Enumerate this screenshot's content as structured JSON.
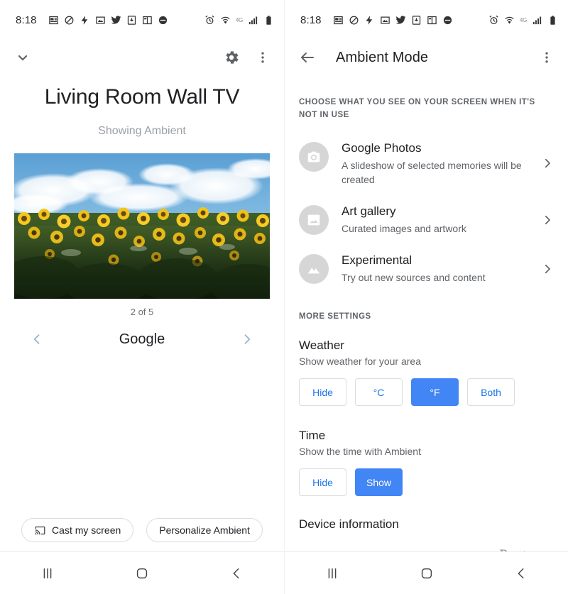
{
  "statusbar": {
    "time": "8:18",
    "left_icons": [
      "news-icon",
      "no-sim-icon",
      "flash-icon",
      "photo-icon",
      "twitter-icon",
      "download-icon",
      "book-icon",
      "more-notifications-icon"
    ],
    "right_icons": [
      "alarm-icon",
      "wifi-icon",
      "signal-icon",
      "battery-icon"
    ],
    "network_label": "4G"
  },
  "left": {
    "header": {
      "collapse_icon": "chevron-down-icon",
      "settings_icon": "gear-icon",
      "overflow_icon": "more-vertical-icon"
    },
    "device_title": "Living Room Wall TV",
    "device_status": "Showing Ambient",
    "photo_alt": "sunflower-field-photo",
    "counter": "2 of 5",
    "carousel": {
      "prev_icon": "chevron-left-icon",
      "label": "Google",
      "next_icon": "chevron-right-icon"
    },
    "actions": {
      "cast_icon": "cast-icon",
      "cast_label": "Cast my screen",
      "personalize_label": "Personalize Ambient"
    }
  },
  "right": {
    "header": {
      "back_icon": "arrow-left-icon",
      "title": "Ambient Mode",
      "overflow_icon": "more-vertical-icon"
    },
    "section_choose": "CHOOSE WHAT YOU SEE ON YOUR SCREEN WHEN IT'S NOT IN USE",
    "sources": [
      {
        "icon": "camera-icon",
        "title": "Google Photos",
        "desc": "A slideshow of selected memories will be created",
        "chevron": "chevron-right-icon"
      },
      {
        "icon": "image-icon",
        "title": "Art gallery",
        "desc": "Curated images and artwork",
        "chevron": "chevron-right-icon"
      },
      {
        "icon": "mountain-icon",
        "title": "Experimental",
        "desc": "Try out new sources and content",
        "chevron": "chevron-right-icon"
      }
    ],
    "section_more": "MORE SETTINGS",
    "weather": {
      "title": "Weather",
      "desc": "Show weather for your area",
      "options": [
        {
          "label": "Hide",
          "selected": false
        },
        {
          "label": "°C",
          "selected": false
        },
        {
          "label": "°F",
          "selected": true
        },
        {
          "label": "Both",
          "selected": false
        }
      ]
    },
    "time": {
      "title": "Time",
      "desc": "Show the time with Ambient",
      "options": [
        {
          "label": "Hide",
          "selected": false
        },
        {
          "label": "Show",
          "selected": true
        }
      ]
    },
    "device_information": "Device information",
    "watermark": "groovyPost.com"
  },
  "navbar": {
    "recents_icon": "recents-icon",
    "home_icon": "home-icon",
    "back_icon": "back-icon"
  },
  "colors": {
    "accent_blue": "#4285f4",
    "link_blue": "#1a73e8",
    "text_primary": "#202124",
    "text_secondary": "#5f6368"
  }
}
